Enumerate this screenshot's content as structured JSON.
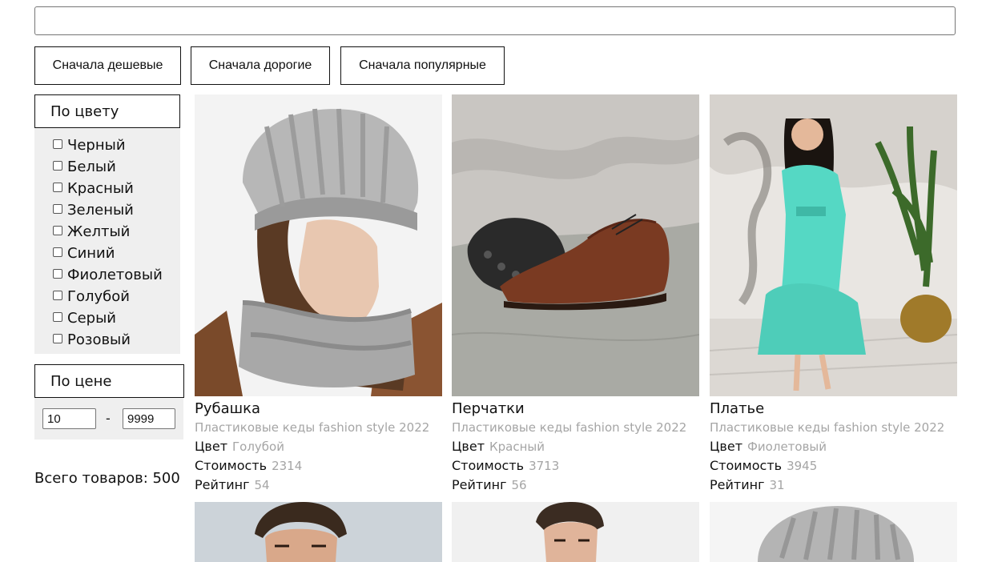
{
  "search": {
    "value": "",
    "placeholder": ""
  },
  "sort_buttons": [
    "Сначала дешевые",
    "Сначала дорогие",
    "Сначала популярные"
  ],
  "filters": {
    "color": {
      "title": "По цвету",
      "options": [
        "Черный",
        "Белый",
        "Красный",
        "Зеленый",
        "Желтый",
        "Синий",
        "Фиолетовый",
        "Голубой",
        "Серый",
        "Розовый"
      ]
    },
    "price": {
      "title": "По цене",
      "min": "10",
      "max": "9999",
      "separator": "-"
    }
  },
  "total": "Всего товаров: 500",
  "labels": {
    "color": "Цвет",
    "price": "Стоимость",
    "rating": "Рейтинг"
  },
  "products": [
    {
      "title": "Рубашка",
      "desc": "Пластиковые кеды fashion style 2022",
      "color": "Голубой",
      "price": "2314",
      "rating": "54"
    },
    {
      "title": "Перчатки",
      "desc": "Пластиковые кеды fashion style 2022",
      "color": "Красный",
      "price": "3713",
      "rating": "56"
    },
    {
      "title": "Платье",
      "desc": "Пластиковые кеды fashion style 2022",
      "color": "Фиолетовый",
      "price": "3945",
      "rating": "31"
    }
  ]
}
